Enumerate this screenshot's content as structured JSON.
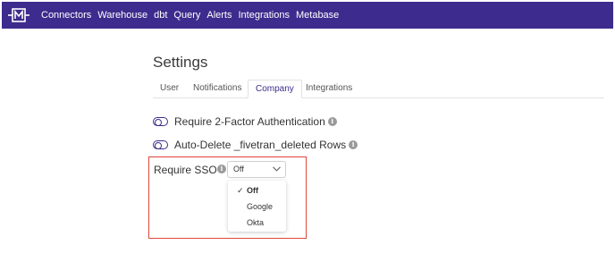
{
  "nav": {
    "items": [
      "Connectors",
      "Warehouse",
      "dbt",
      "Query",
      "Alerts",
      "Integrations",
      "Metabase"
    ],
    "background": "#3d2c8d"
  },
  "page": {
    "title": "Settings"
  },
  "tabs": [
    {
      "label": "User",
      "active": false
    },
    {
      "label": "Notifications",
      "active": false
    },
    {
      "label": "Company",
      "active": true
    },
    {
      "label": "Integrations",
      "active": false
    }
  ],
  "settings": {
    "two_factor_label": "Require 2-Factor Authentication",
    "auto_delete_label": "Auto-Delete _fivetran_deleted Rows",
    "sso_label": "Require SSO"
  },
  "sso_select": {
    "value": "Off",
    "options": [
      "Off",
      "Google",
      "Okta"
    ],
    "selected_index": 0
  },
  "colors": {
    "accent": "#3d2c8d",
    "highlight": "#e0453a"
  },
  "icons": {
    "info": "info-icon",
    "check": "checkmark-icon",
    "chevron": "chevron-down-icon",
    "logo": "logo-icon"
  }
}
